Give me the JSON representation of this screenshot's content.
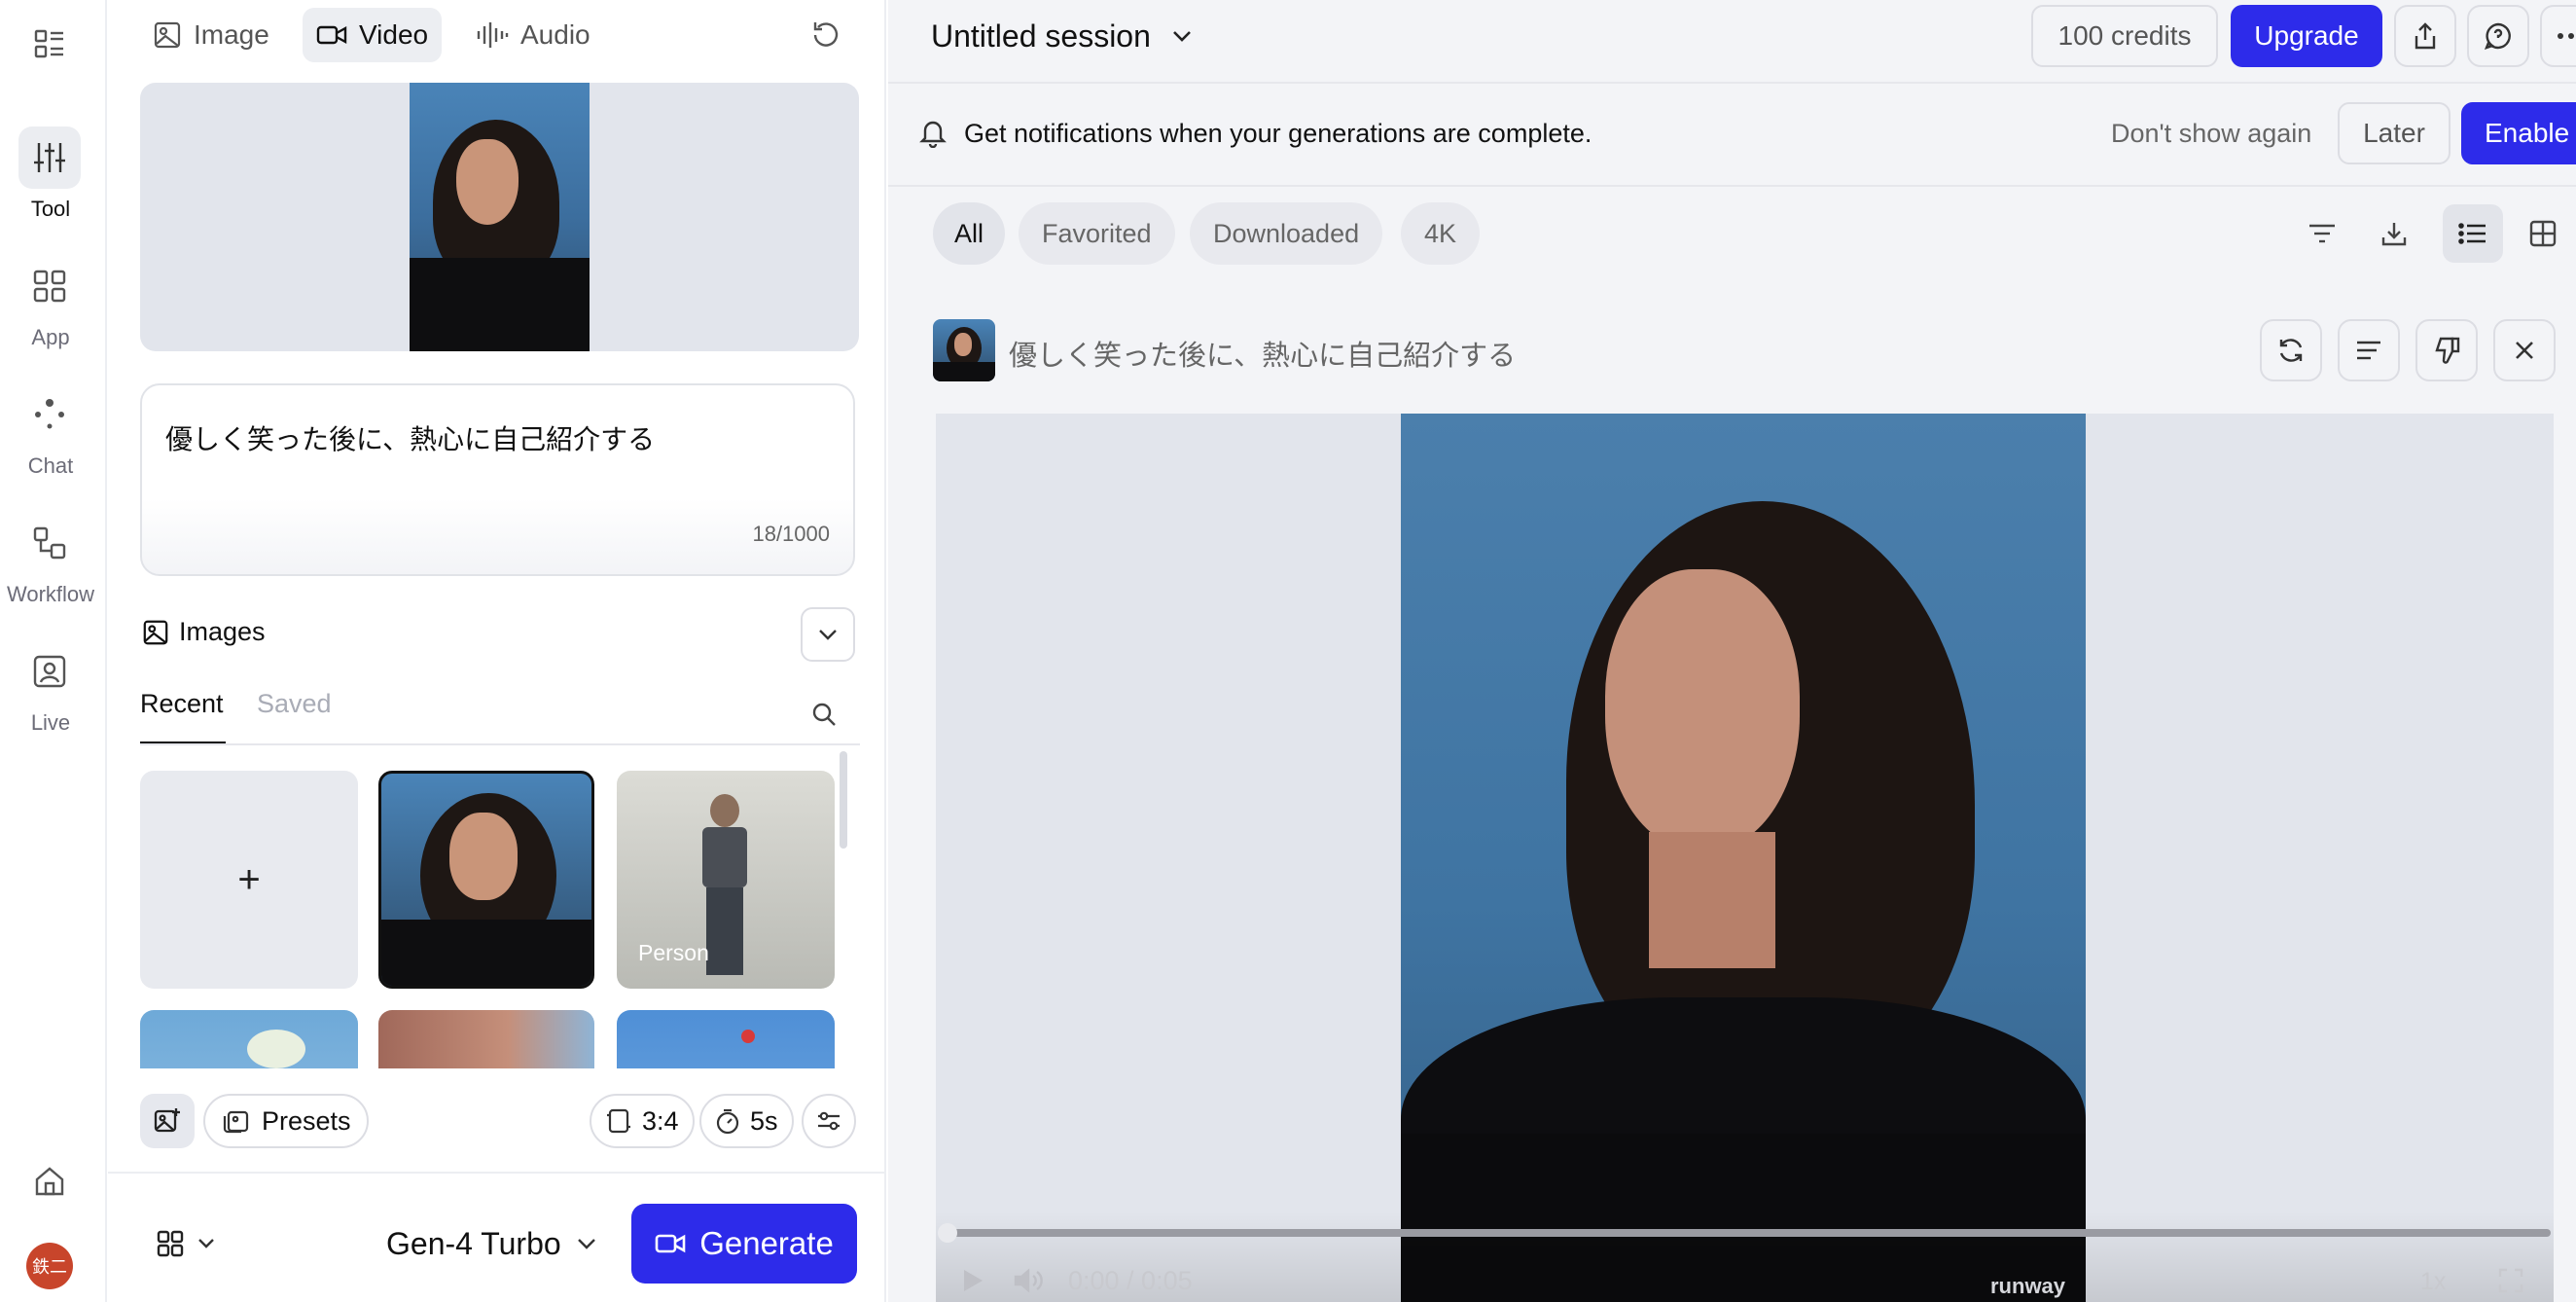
{
  "nav": {
    "items": [
      {
        "label": "Tool"
      },
      {
        "label": "App"
      },
      {
        "label": "Chat"
      },
      {
        "label": "Workflow"
      },
      {
        "label": "Live"
      }
    ],
    "avatar_text": "鉄二"
  },
  "left": {
    "mode_tabs": [
      "Image",
      "Video",
      "Audio"
    ],
    "prompt": "優しく笑った後に、熱心に自己紹介する",
    "char_count": "18/1000",
    "images_header": "Images",
    "image_tabs": [
      "Recent",
      "Saved"
    ],
    "add_label": "+",
    "person_label": "Person",
    "presets_label": "Presets",
    "ratio_label": "3:4",
    "duration_label": "5s",
    "model_label": "Gen-4 Turbo",
    "generate_label": "Generate"
  },
  "header": {
    "session_title": "Untitled session",
    "credits": "100 credits",
    "upgrade_label": "Upgrade"
  },
  "banner": {
    "message": "Get notifications when your generations are complete.",
    "dont_show": "Don't show again",
    "later": "Later",
    "enable": "Enable"
  },
  "filters": [
    "All",
    "Favorited",
    "Downloaded",
    "4K"
  ],
  "generation": {
    "prompt": "優しく笑った後に、熱心に自己紹介する",
    "time": "0:00 / 0:05",
    "watermark": "runway",
    "speed": "1x"
  },
  "colors": {
    "accent": "#2d2bea",
    "bg_panel": "#f3f4f7",
    "border": "#dcdde3"
  }
}
